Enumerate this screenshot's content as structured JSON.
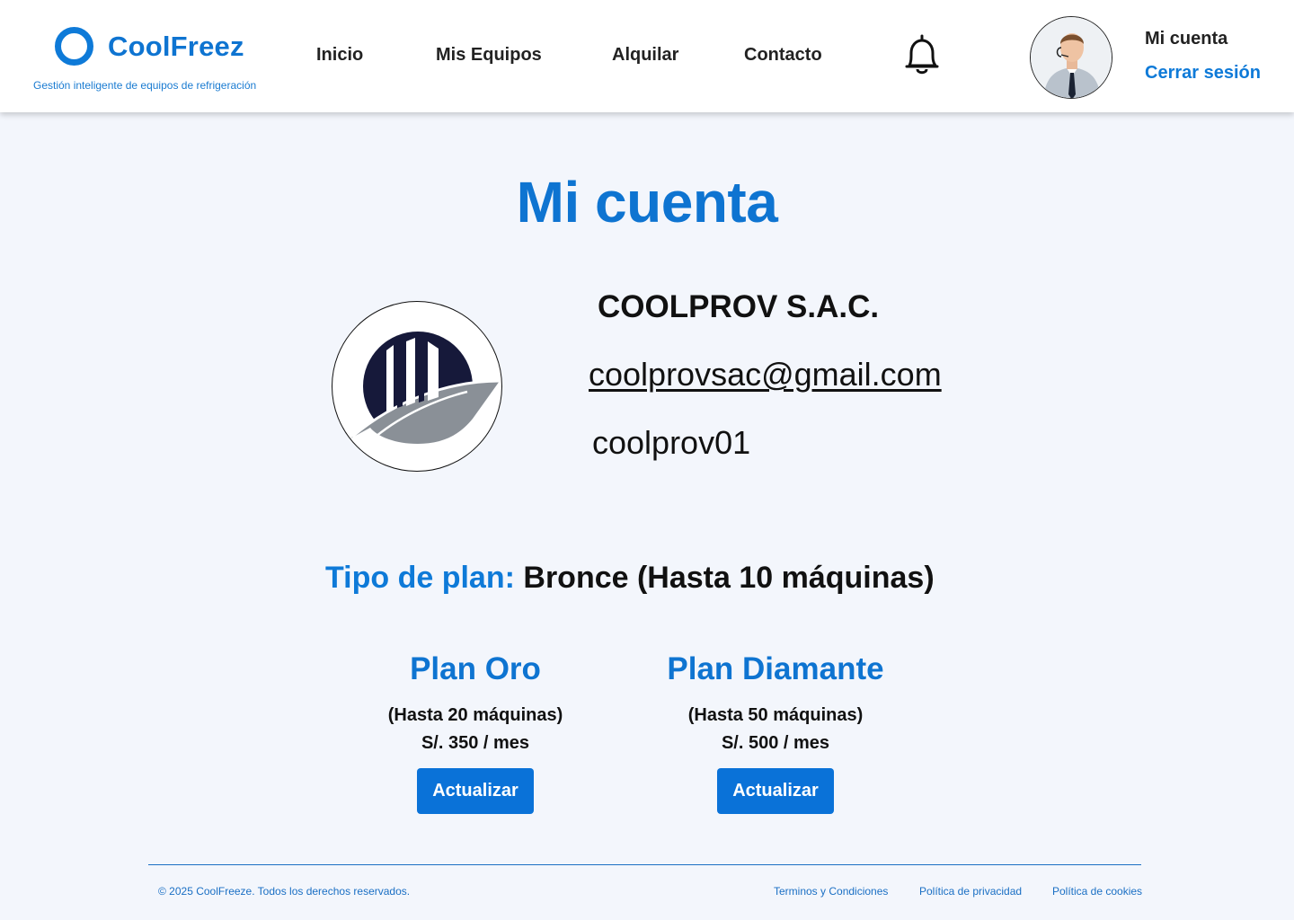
{
  "header": {
    "brand_name": "CoolFreez",
    "tagline": "Gestión inteligente de equipos de refrigeración",
    "nav": [
      "Inicio",
      "Mis Equipos",
      "Alquilar",
      "Contacto"
    ],
    "account_label": "Mi cuenta",
    "logout_label": "Cerrar sesión"
  },
  "main": {
    "title": "Mi cuenta",
    "company": {
      "name": "COOLPROV S.A.C.",
      "email": "coolprovsac@gmail.com",
      "username": "coolprov01"
    },
    "current_plan": {
      "label": "Tipo de plan:",
      "value": "Bronce (Hasta 10 máquinas)"
    },
    "plans": [
      {
        "name": "Plan Oro",
        "limit": "(Hasta 20 máquinas)",
        "price": "S/. 350 / mes",
        "button": "Actualizar"
      },
      {
        "name": "Plan Diamante",
        "limit": "(Hasta 50 máquinas)",
        "price": "S/. 500 / mes",
        "button": "Actualizar"
      }
    ]
  },
  "footer": {
    "copyright": "© 2025 CoolFreeze. Todos los derechos reservados.",
    "links": [
      "Terminos y Condiciones",
      "Política de privacidad",
      "Política de cookies"
    ]
  },
  "colors": {
    "primary": "#0e74d1",
    "button": "#0a72d8",
    "background": "#f3f6fc",
    "header_bg": "#ffffff"
  },
  "icons": {
    "brand": "ring-logo-icon",
    "notification": "bell-icon",
    "avatar": "user-avatar-photo",
    "company": "building-logo-icon"
  }
}
